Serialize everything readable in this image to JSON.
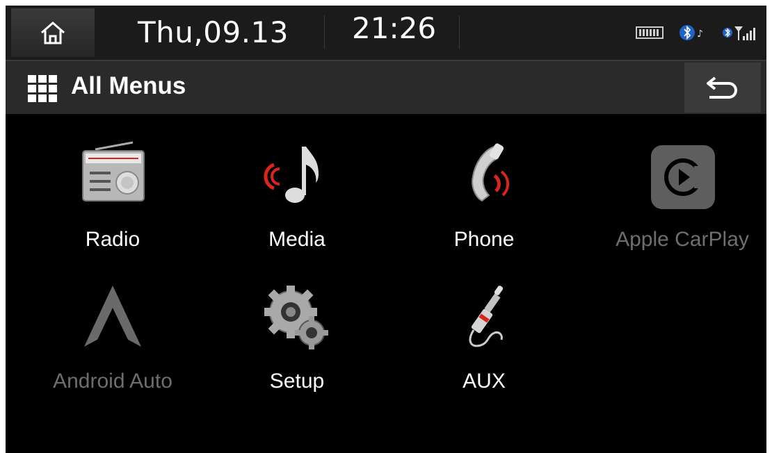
{
  "status_bar": {
    "date": "Thu,09.13",
    "time": "21:26"
  },
  "title_bar": {
    "title": "All Menus"
  },
  "menu": [
    {
      "label": "Radio",
      "icon": "radio-icon",
      "enabled": true
    },
    {
      "label": "Media",
      "icon": "music-note-icon",
      "enabled": true
    },
    {
      "label": "Phone",
      "icon": "phone-icon",
      "enabled": true
    },
    {
      "label": "Apple CarPlay",
      "icon": "carplay-icon",
      "enabled": false
    },
    {
      "label": "Android Auto",
      "icon": "android-auto-icon",
      "enabled": false
    },
    {
      "label": "Setup",
      "icon": "gear-icon",
      "enabled": true
    },
    {
      "label": "AUX",
      "icon": "aux-jack-icon",
      "enabled": true
    }
  ],
  "colors": {
    "background": "#000000",
    "accent_red": "#d8261c",
    "disabled_text": "#6e6e6e"
  }
}
